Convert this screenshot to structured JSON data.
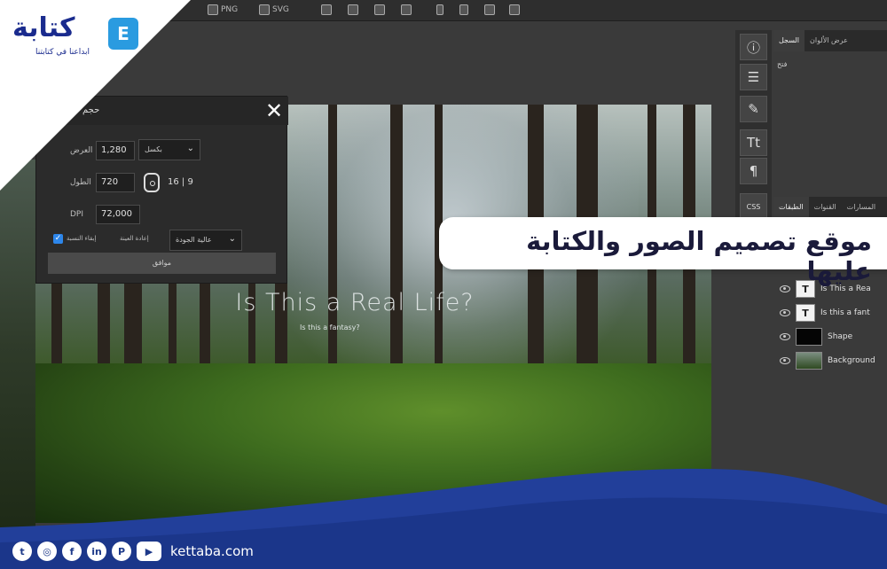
{
  "toolbar": {
    "items": [
      "PNG",
      "SVG"
    ],
    "icons": [
      "download-icon",
      "download-icon",
      "layer-icon",
      "stamp-icon",
      "image-icon",
      "flag-icon",
      "phone-icon",
      "tablet-icon",
      "desktop-icon",
      "expand-icon"
    ]
  },
  "logo": {
    "word": "كتابة",
    "tagline": "ابداعنا في كتابتنا",
    "mark": "E"
  },
  "dialog": {
    "title": "حجم",
    "width_label": "العرض",
    "width_value": "1,280",
    "unit_select": "بكسل",
    "height_label": "الطول",
    "height_value": "720",
    "ratio": "16 | 9",
    "dpi_label": "DPI",
    "dpi_value": "72,000",
    "keep_ratio_label": "إبقاء النسبة",
    "keep_ratio_checked": true,
    "resample_label": "إعادة العينة",
    "quality_select": "عالية الجودة",
    "ok_label": "موافق"
  },
  "canvas": {
    "title": "Is This a Real Life?",
    "subtitle": "Is this a fantasy?"
  },
  "tools": [
    "info-icon",
    "sliders-icon",
    "brush-icon",
    "text-icon",
    "paragraph-icon",
    "css-icon"
  ],
  "tool_labels": {
    "text": "Tt",
    "paragraph": "¶",
    "css": "CSS"
  },
  "history_panel": {
    "tabs": [
      "السجل",
      "عرض الألوان"
    ],
    "first_row": "فتح"
  },
  "layers_panel": {
    "tabs": [
      "الطبقات",
      "القنوات",
      "المسارات"
    ],
    "layers": [
      {
        "name": "Is This a Rea",
        "thumb": "T"
      },
      {
        "name": "Is this a fant",
        "thumb": "T"
      },
      {
        "name": "Shape",
        "thumb": ""
      },
      {
        "name": "Background",
        "thumb": ""
      }
    ]
  },
  "banner": {
    "text": "موقع تصميم الصور والكتابة عليها"
  },
  "footer": {
    "social": [
      "twitter-icon",
      "instagram-icon",
      "facebook-icon",
      "linkedin-icon",
      "pinterest-icon",
      "youtube-icon"
    ],
    "site": "kettaba.com"
  },
  "colors": {
    "accent_blue": "#1e3a8a",
    "wave_blue": "#223f9a",
    "checkbox_blue": "#2d86ea"
  }
}
